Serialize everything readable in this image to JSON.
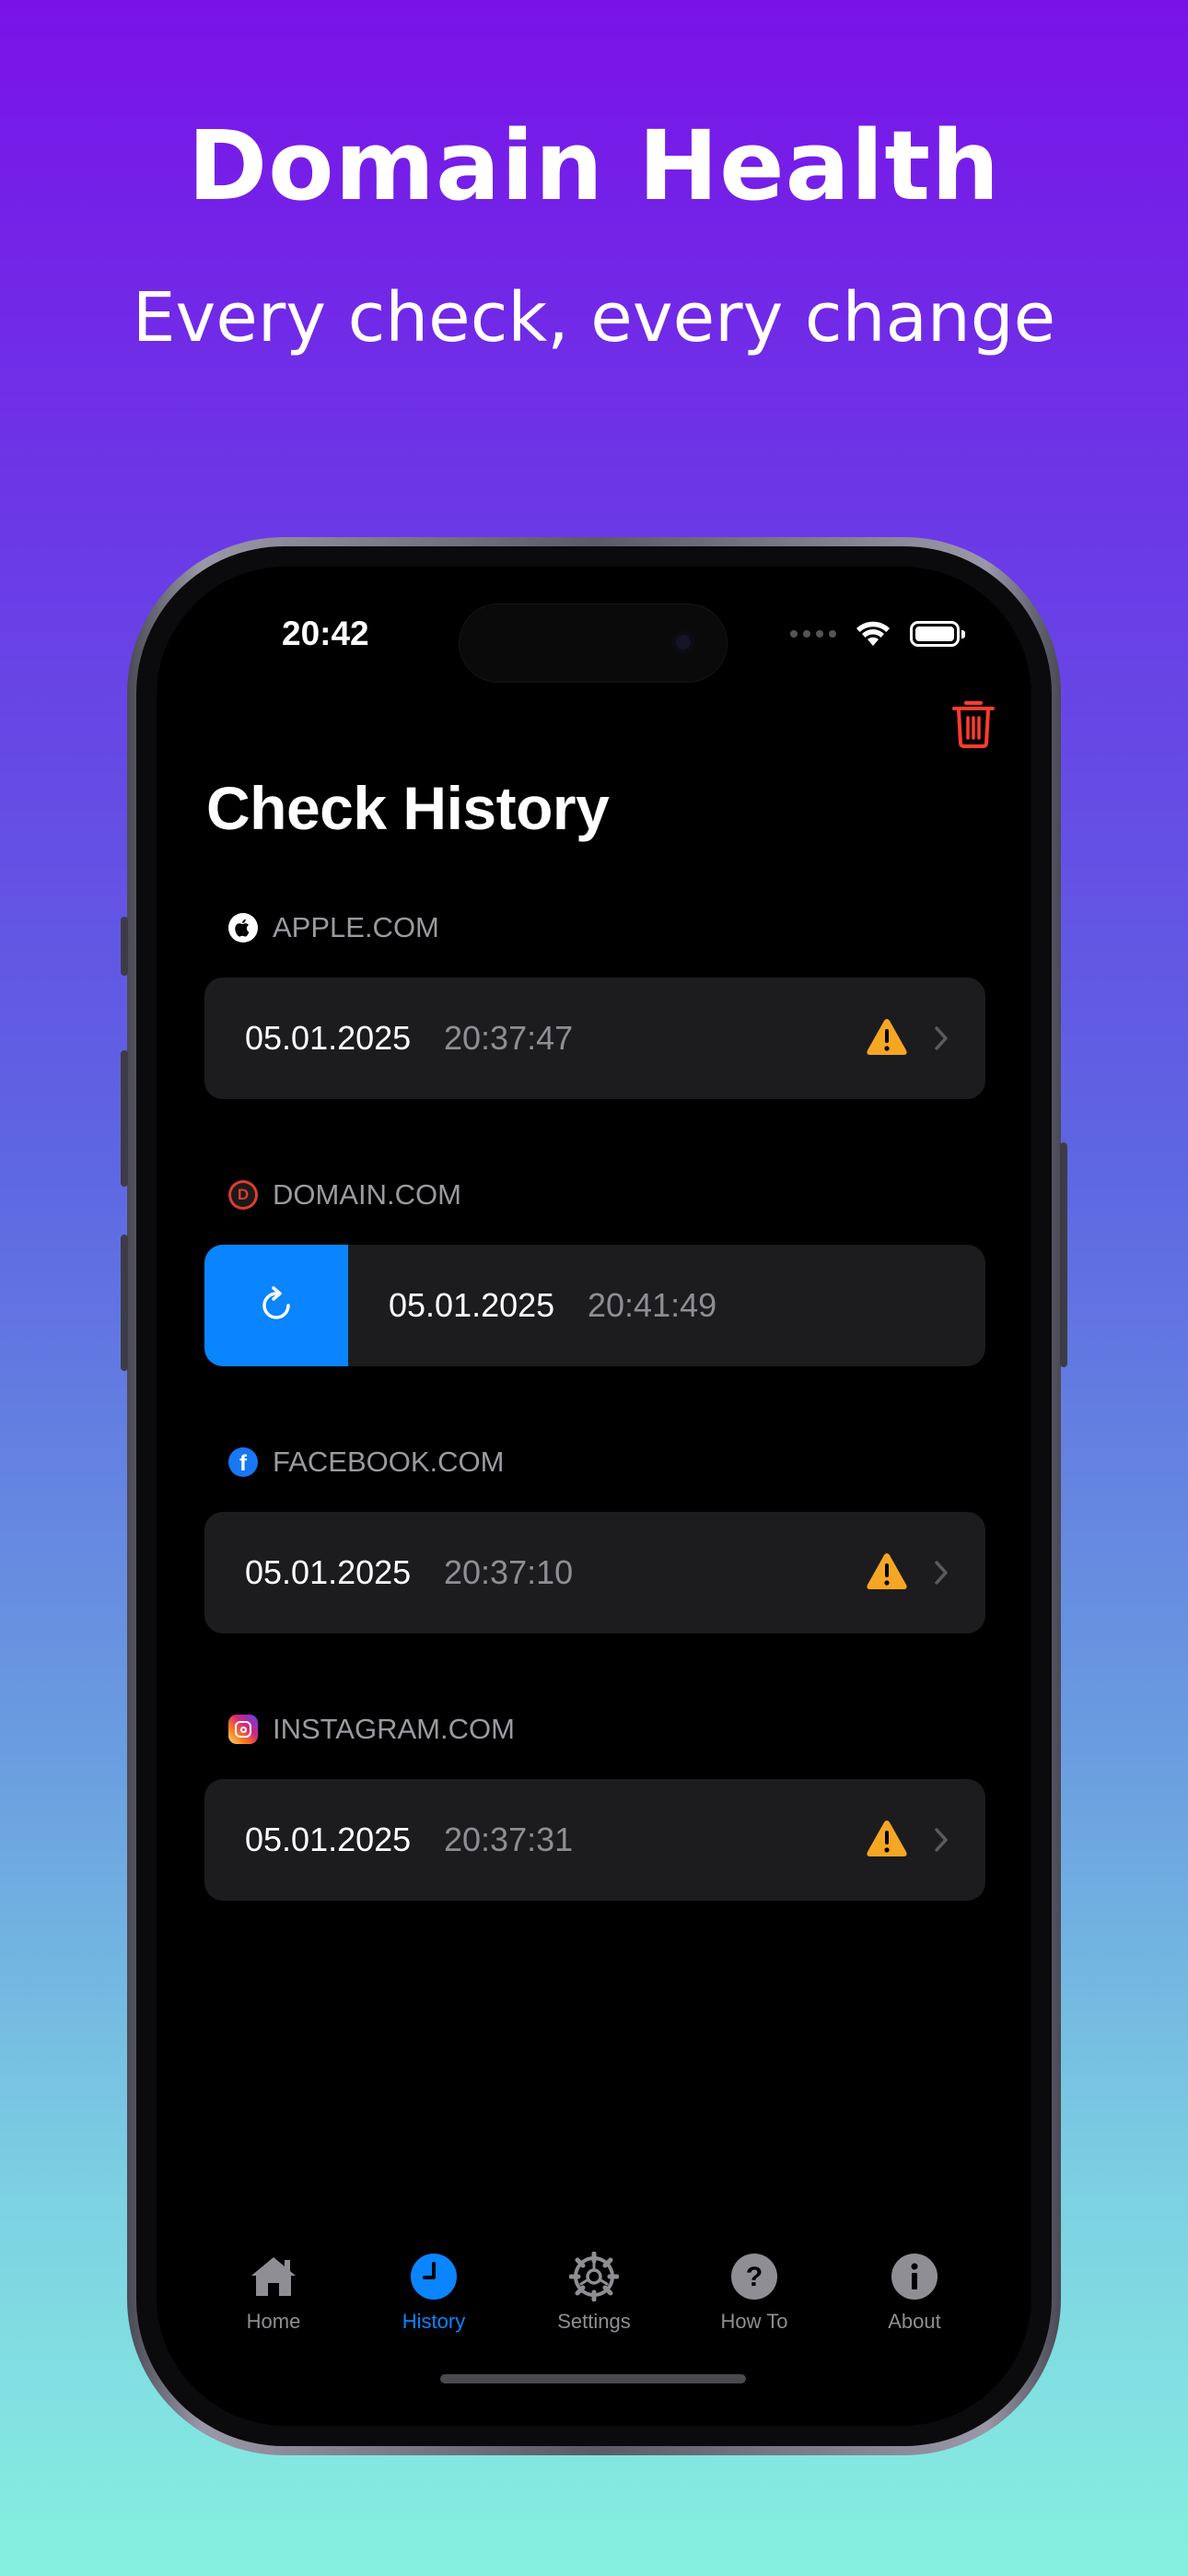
{
  "hero": {
    "title": "Domain Health",
    "subtitle": "Every check, every change"
  },
  "status_bar": {
    "time": "20:42"
  },
  "page": {
    "title": "Check History"
  },
  "sections": [
    {
      "domain": "APPLE.COM",
      "icon": "apple-logo-icon",
      "date": "05.01.2025",
      "time": "20:37:47",
      "status": "warning"
    },
    {
      "domain": "DOMAIN.COM",
      "icon": "domain-logo-icon",
      "date": "05.01.2025",
      "time": "20:41:49",
      "status": "none",
      "swipe_action": "refresh"
    },
    {
      "domain": "FACEBOOK.COM",
      "icon": "facebook-logo-icon",
      "date": "05.01.2025",
      "time": "20:37:10",
      "status": "warning"
    },
    {
      "domain": "INSTAGRAM.COM",
      "icon": "instagram-logo-icon",
      "date": "05.01.2025",
      "time": "20:37:31",
      "status": "warning"
    }
  ],
  "tabs": [
    {
      "label": "Home",
      "icon": "house-icon",
      "active": false
    },
    {
      "label": "History",
      "icon": "clock-icon",
      "active": true
    },
    {
      "label": "Settings",
      "icon": "gear-icon",
      "active": false
    },
    {
      "label": "How To",
      "icon": "question-icon",
      "active": false
    },
    {
      "label": "About",
      "icon": "info-icon",
      "active": false
    }
  ],
  "colors": {
    "accent": "#0a84ff",
    "warning": "#f5a623",
    "destructive": "#ff3b30",
    "row_bg": "#1c1c1e"
  }
}
